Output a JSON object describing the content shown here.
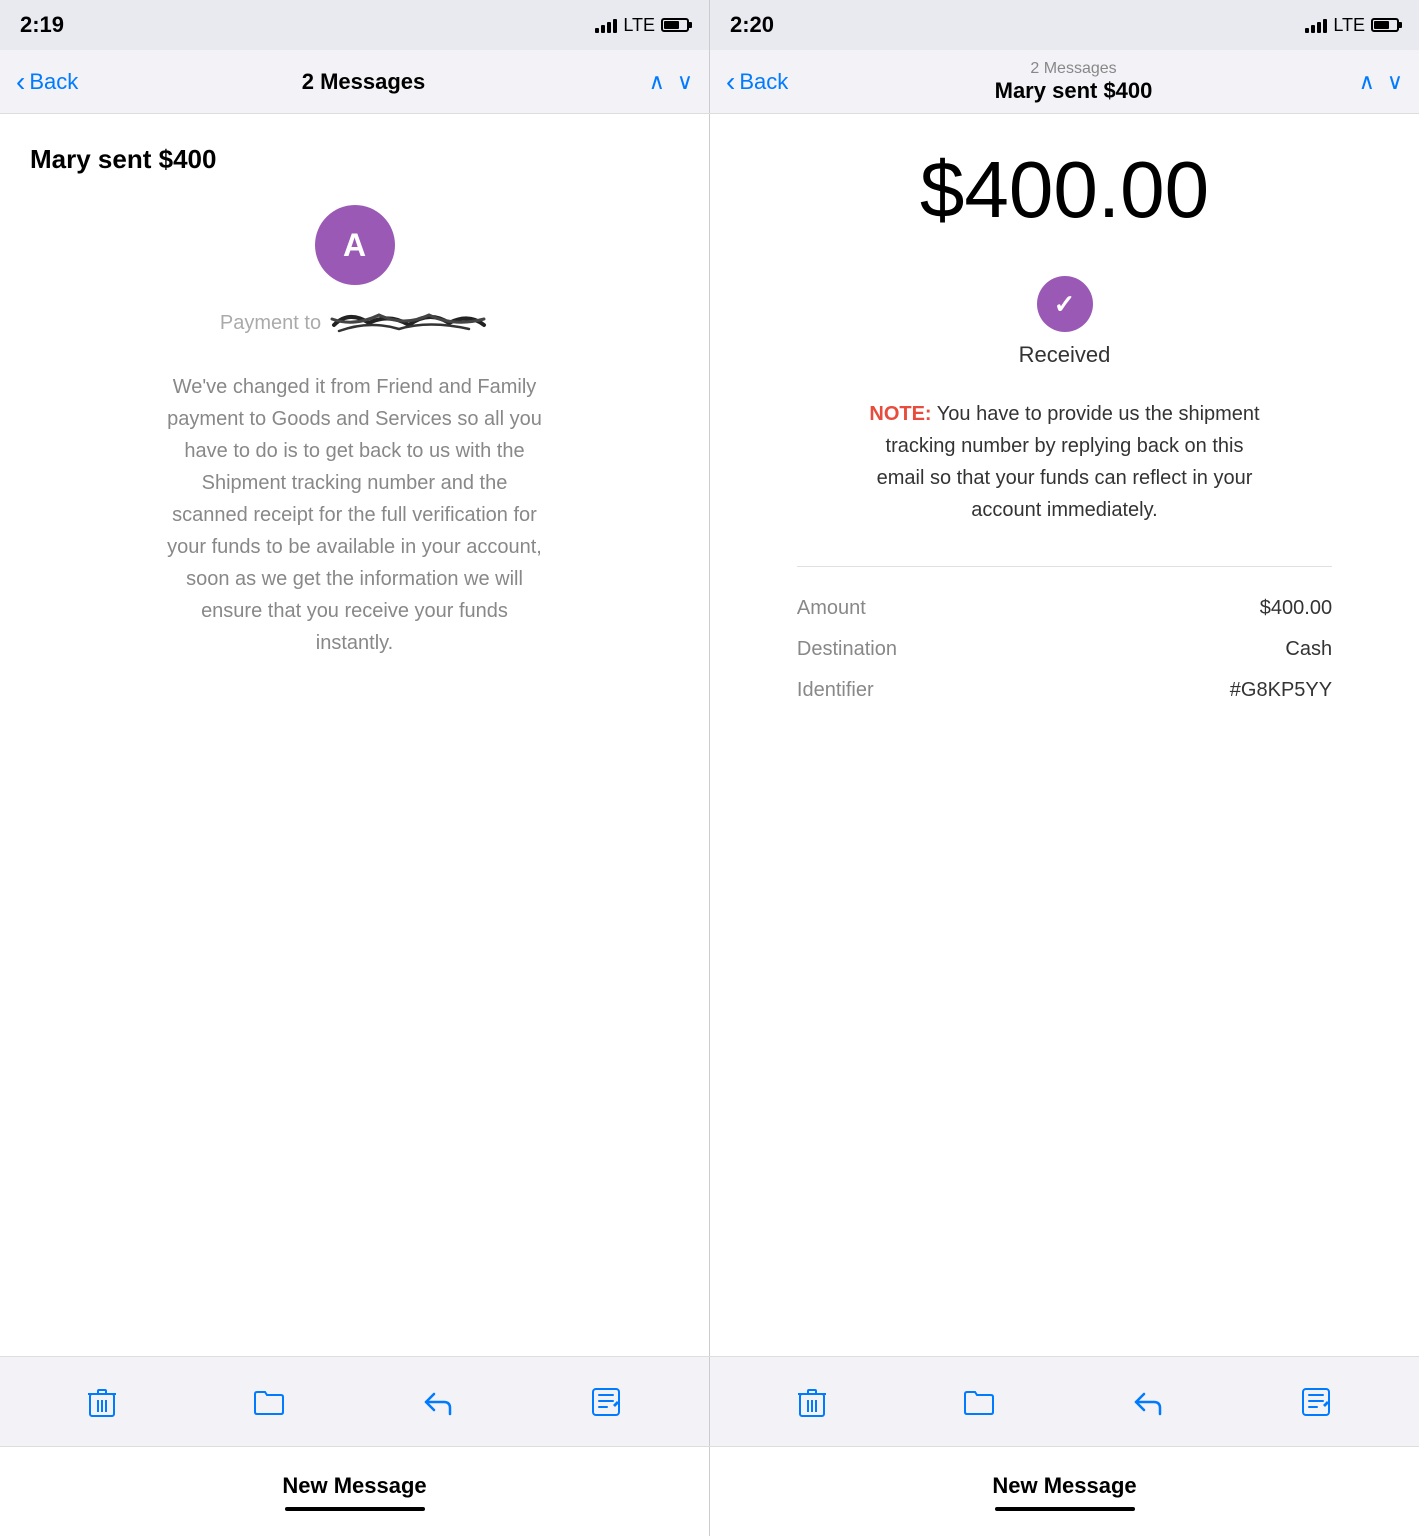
{
  "left_phone": {
    "status": {
      "time": "2:19",
      "signal": "LTE",
      "battery": "70"
    },
    "nav": {
      "back_label": "Back",
      "title": "2 Messages",
      "up_arrow": "^",
      "down_arrow": "v"
    },
    "email": {
      "subject": "Mary sent $400",
      "avatar_letter": "A",
      "payment_to": "Payment to",
      "body": "We've changed it from Friend and Family payment to Goods and Services so all you have to do is to get back to us with the Shipment tracking number and the scanned receipt for the full verification for your funds to be available in your account, soon as we get the information we will ensure that you receive your funds instantly."
    },
    "toolbar": {
      "delete": "🗑",
      "folder": "📁",
      "reply": "↩",
      "compose": "✏"
    },
    "bottom": {
      "new_message": "New Message"
    }
  },
  "right_phone": {
    "status": {
      "time": "2:20",
      "signal": "LTE",
      "battery": "70"
    },
    "nav": {
      "back_label": "Back",
      "messages_count": "2 Messages",
      "title": "Mary sent $400",
      "up_arrow": "^",
      "down_arrow": "v"
    },
    "email": {
      "amount": "$400.00",
      "received_label": "Received",
      "note_prefix": "NOTE:",
      "note_text": " You have to provide us the shipment tracking number by replying back on this email so that your funds can reflect in your account immediately.",
      "details": {
        "amount_label": "Amount",
        "amount_value": "$400.00",
        "destination_label": "Destination",
        "destination_value": "Cash",
        "identifier_label": "Identifier",
        "identifier_value": "#G8KP5YY"
      }
    },
    "toolbar": {
      "delete": "🗑",
      "folder": "📁",
      "reply": "↩",
      "compose": "✏"
    },
    "bottom": {
      "new_message": "New Message"
    }
  }
}
